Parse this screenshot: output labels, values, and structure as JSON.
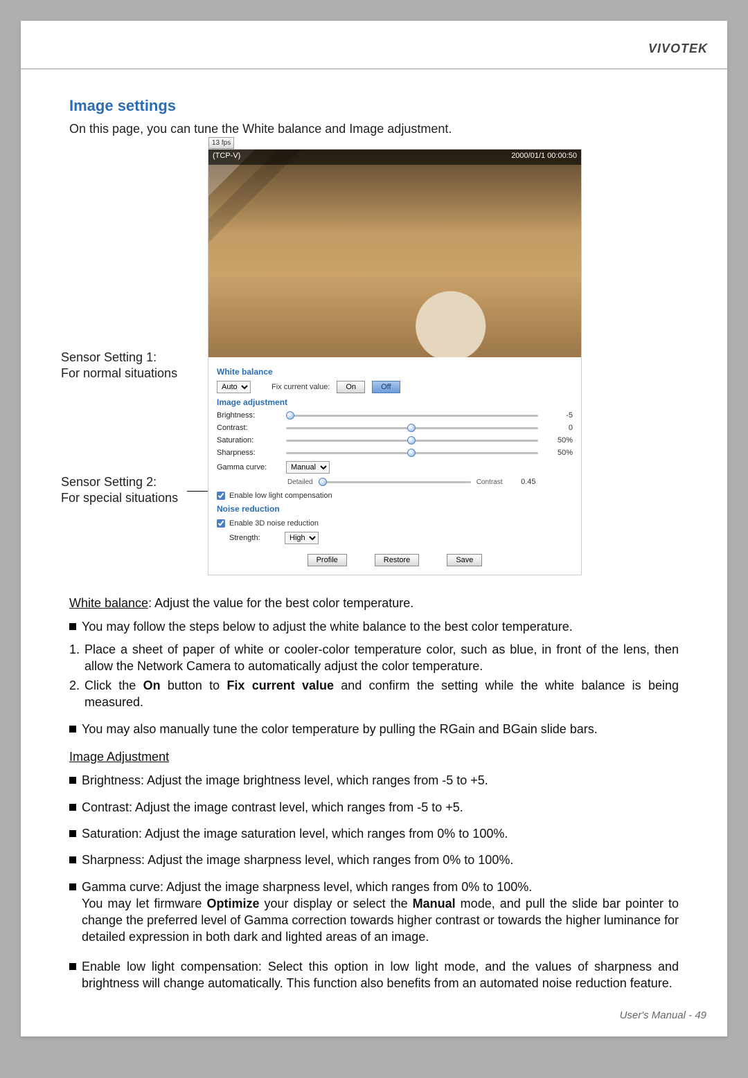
{
  "brand": "VIVOTEK",
  "section_title": "Image settings",
  "intro": "On this page, you can tune the White balance and Image adjustment.",
  "ui": {
    "toolbar_btn": "13 fps",
    "video_stream_label": "(TCP-V)",
    "video_time": "2000/01/1 00:00:50",
    "white_balance_label": "White balance",
    "wb_mode": "Auto",
    "wb_fix_label": "Fix current value:",
    "wb_on": "On",
    "wb_off": "Off",
    "image_adj_label": "Image adjustment",
    "brightness_label": "Brightness:",
    "brightness_val": "-5",
    "contrast_label": "Contrast:",
    "contrast_val": "0",
    "saturation_label": "Saturation:",
    "saturation_val": "50%",
    "sharpness_label": "Sharpness:",
    "sharpness_val": "50%",
    "gamma_label": "Gamma curve:",
    "gamma_mode": "Manual",
    "gamma_detailed": "Detailed",
    "gamma_contrast": "Contrast",
    "gamma_val": "0.45",
    "lowlight_label": "Enable low light compensation",
    "noise_red_label": "Noise reduction",
    "enable3d_label": "Enable 3D noise reduction",
    "strength_label": "Strength:",
    "strength_val": "High",
    "btn_profile": "Profile",
    "btn_restore": "Restore",
    "btn_save": "Save"
  },
  "anno1_title": "Sensor Setting 1:",
  "anno1_desc": "For normal situations",
  "anno2_title": "Sensor Setting 2:",
  "anno2_desc": "For special situations",
  "wb_u": "White balance",
  "wb_rest": ": Adjust the value for the best color temperature.",
  "wb_bul1": "You may follow the steps below to adjust the white balance to the best color temperature.",
  "step1": "Place a sheet of paper of white or cooler-color temperature color, such as blue, in front of the lens, then allow the Network Camera to automatically adjust the color temperature.",
  "step2a": "Click the ",
  "step2b": "On",
  "step2c": " button to ",
  "step2d": "Fix current value",
  "step2e": " and confirm the setting while the white balance is being measured.",
  "wb_bul2": "You may also manually tune the color temperature by pulling the RGain and BGain slide bars.",
  "ia_u": "Image Adjustment",
  "ia_brightness": "Brightness: Adjust the image brightness level, which ranges from -5 to +5.",
  "ia_contrast": "Contrast: Adjust the image contrast level, which ranges from -5 to +5.",
  "ia_saturation": "Saturation: Adjust the image saturation level, which ranges from 0% to 100%.",
  "ia_sharpness": "Sharpness: Adjust the image sharpness level, which ranges from 0% to 100%.",
  "ia_gamma1": "Gamma curve: Adjust the image sharpness level, which ranges from 0% to 100%.",
  "ia_gamma2a": "You may let firmware ",
  "ia_gamma2b": "Optimize",
  "ia_gamma2c": " your display or select the ",
  "ia_gamma2d": "Manual",
  "ia_gamma2e": " mode, and pull the slide bar pointer to change the preferred level of Gamma correction towards higher contrast or towards the higher luminance for detailed expression in both dark and lighted areas of an image.",
  "ia_lowlight": "Enable low light compensation: Select this option in low light mode, and the values of sharpness and brightness will change automatically. This function also benefits from an automated noise reduction feature.",
  "footer_label": "User's Manual - ",
  "footer_page": "49"
}
